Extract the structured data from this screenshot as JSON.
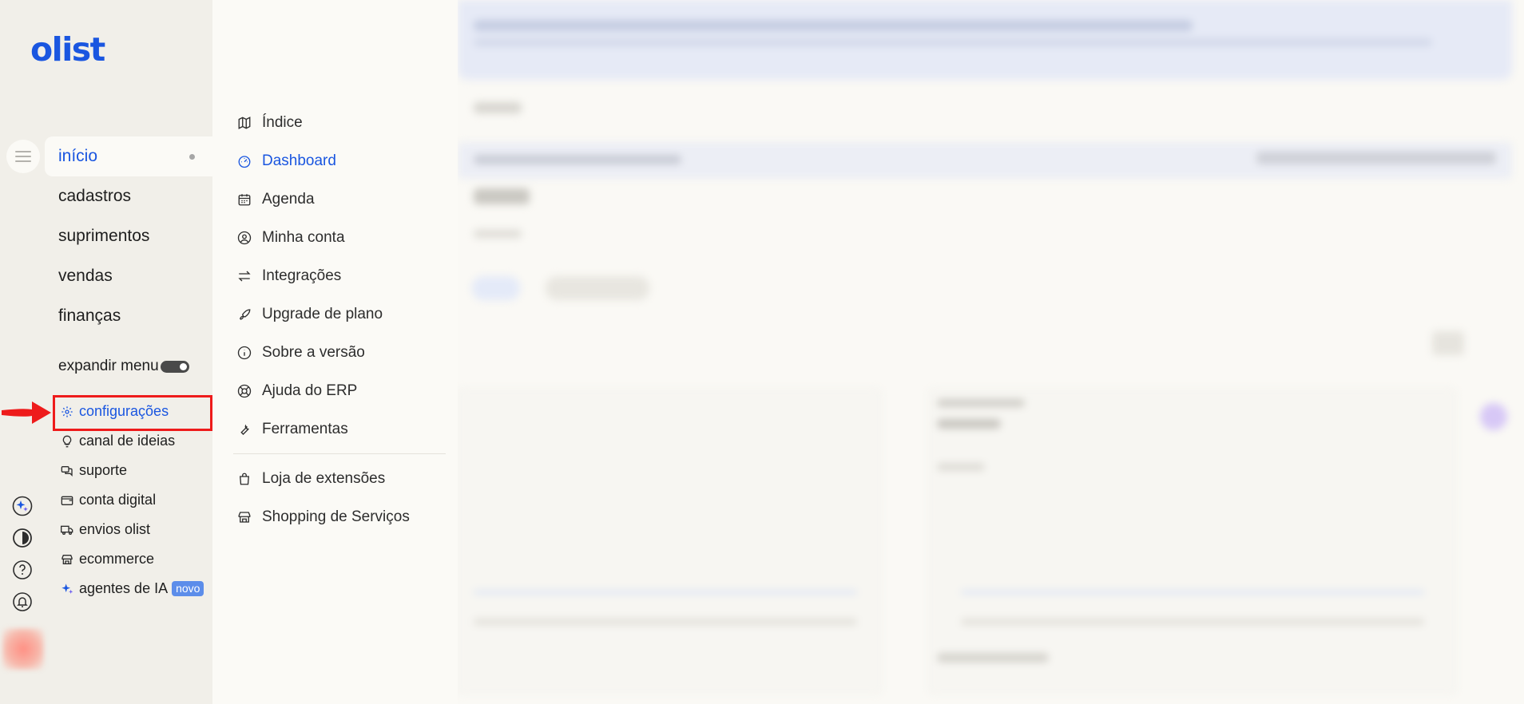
{
  "brand": {
    "logo_text": "olist",
    "accent": "#1a56e0"
  },
  "main_nav": [
    {
      "id": "inicio",
      "label": "início",
      "active": true
    },
    {
      "id": "cadastros",
      "label": "cadastros"
    },
    {
      "id": "suprimentos",
      "label": "suprimentos"
    },
    {
      "id": "vendas",
      "label": "vendas"
    },
    {
      "id": "financas",
      "label": "finanças"
    }
  ],
  "expand_menu": {
    "label": "expandir menu",
    "on": true
  },
  "sub_nav": [
    {
      "id": "configuracoes",
      "label": "configurações",
      "icon": "gear-icon",
      "highlight": true
    },
    {
      "id": "canal-de-ideias",
      "label": "canal de ideias",
      "icon": "lightbulb-icon"
    },
    {
      "id": "suporte",
      "label": "suporte",
      "icon": "chat-bubbles-icon"
    },
    {
      "id": "conta-digital",
      "label": "conta digital",
      "icon": "wallet-icon"
    },
    {
      "id": "envios-olist",
      "label": "envios olist",
      "icon": "truck-icon"
    },
    {
      "id": "ecommerce",
      "label": "ecommerce",
      "icon": "store-icon"
    },
    {
      "id": "agentes-de-ia",
      "label": "agentes de IA",
      "icon": "sparkle-icon",
      "badge": "novo"
    }
  ],
  "bottom_icons": [
    "ai-sparkle-icon",
    "contrast-icon",
    "help-icon",
    "bell-icon"
  ],
  "menu": {
    "items": [
      {
        "id": "indice",
        "label": "Índice",
        "icon": "map-icon"
      },
      {
        "id": "dashboard",
        "label": "Dashboard",
        "icon": "gauge-icon",
        "active": true
      },
      {
        "id": "agenda",
        "label": "Agenda",
        "icon": "calendar-icon"
      },
      {
        "id": "minha-conta",
        "label": "Minha conta",
        "icon": "user-circle-icon"
      },
      {
        "id": "integracoes",
        "label": "Integrações",
        "icon": "arrows-exchange-icon"
      },
      {
        "id": "upgrade-de-plano",
        "label": "Upgrade de plano",
        "icon": "rocket-icon"
      },
      {
        "id": "sobre-a-versao",
        "label": "Sobre a versão",
        "icon": "info-icon"
      },
      {
        "id": "ajuda-do-erp",
        "label": "Ajuda do ERP",
        "icon": "lifebuoy-icon"
      },
      {
        "id": "ferramentas",
        "label": "Ferramentas",
        "icon": "wrench-icon"
      }
    ],
    "extra_items": [
      {
        "id": "loja-de-extensoes",
        "label": "Loja de extensões",
        "icon": "shopping-bag-icon"
      },
      {
        "id": "shopping-de-servicos",
        "label": "Shopping de Serviços",
        "icon": "storefront-icon"
      }
    ]
  },
  "annotation": {
    "callout_color": "#ee1b1b",
    "target": "configurações"
  }
}
